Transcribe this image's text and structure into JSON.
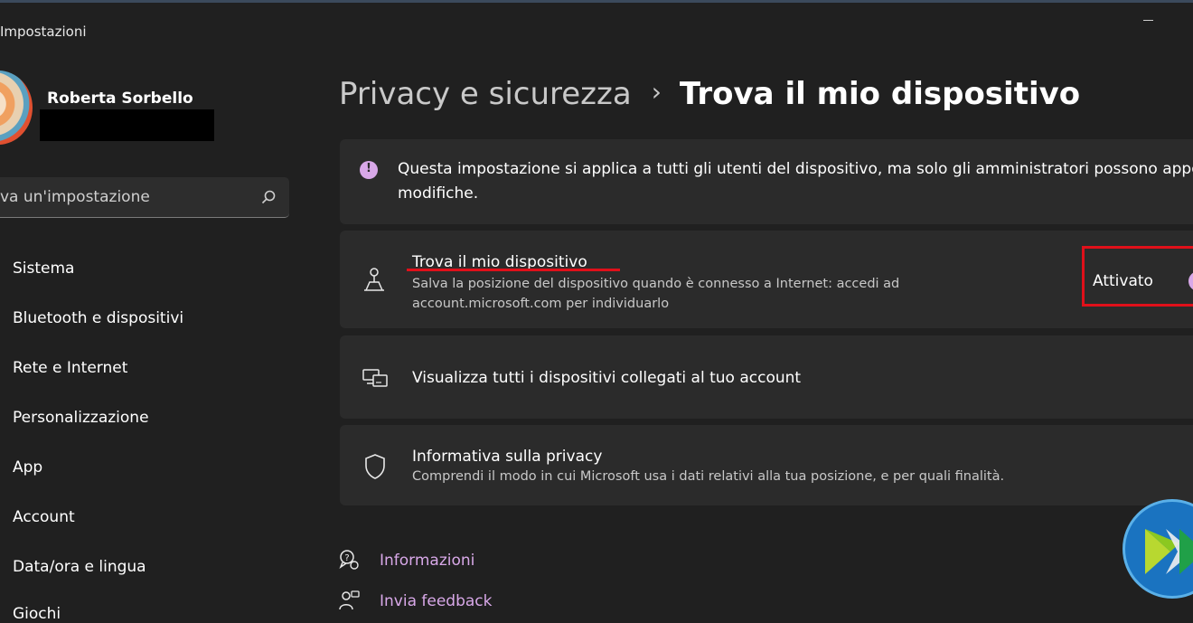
{
  "window": {
    "title": "Impostazioni"
  },
  "user": {
    "name": "Roberta Sorbello"
  },
  "search": {
    "placeholder": "va un'impostazione"
  },
  "sidebar": {
    "items": [
      {
        "label": "Sistema"
      },
      {
        "label": "Bluetooth e dispositivi"
      },
      {
        "label": "Rete e Internet"
      },
      {
        "label": "Personalizzazione"
      },
      {
        "label": "App"
      },
      {
        "label": "Account"
      },
      {
        "label": "Data/ora e lingua"
      },
      {
        "label": "Giochi"
      }
    ]
  },
  "breadcrumb": {
    "parent": "Privacy e sicurezza",
    "separator": "›",
    "current": "Trova il mio dispositivo"
  },
  "info_banner": {
    "line1": "Questa impostazione si applica a tutti gli utenti del dispositivo, ma solo gli amministratori possono appo",
    "line2": "modifiche."
  },
  "find_device": {
    "title": "Trova il mio dispositivo",
    "description_line1": "Salva la posizione del dispositivo quando è connesso a Internet: accedi ad",
    "description_line2": "account.microsoft.com per individuarlo",
    "toggle_label": "Attivato",
    "toggle_on": true
  },
  "devices_link": {
    "label": "Visualizza tutti i dispositivi collegati al tuo account"
  },
  "privacy": {
    "title": "Informativa sulla privacy",
    "description": "Comprendi il modo in cui Microsoft usa i dati relativi alla tua posizione, e per quali finalità."
  },
  "help": {
    "info_label": "Informazioni",
    "feedback_label": "Invia feedback"
  },
  "colors": {
    "background": "#202020",
    "card": "#2b2b2b",
    "accent": "#d8a8e8",
    "annotation_red": "#e0101a"
  },
  "icons": {
    "find_device": "person-location-icon",
    "devices": "devices-icon",
    "privacy": "shield-icon",
    "info_banner": "info-icon",
    "help_info": "help-chat-icon",
    "help_feedback": "feedback-icon"
  }
}
